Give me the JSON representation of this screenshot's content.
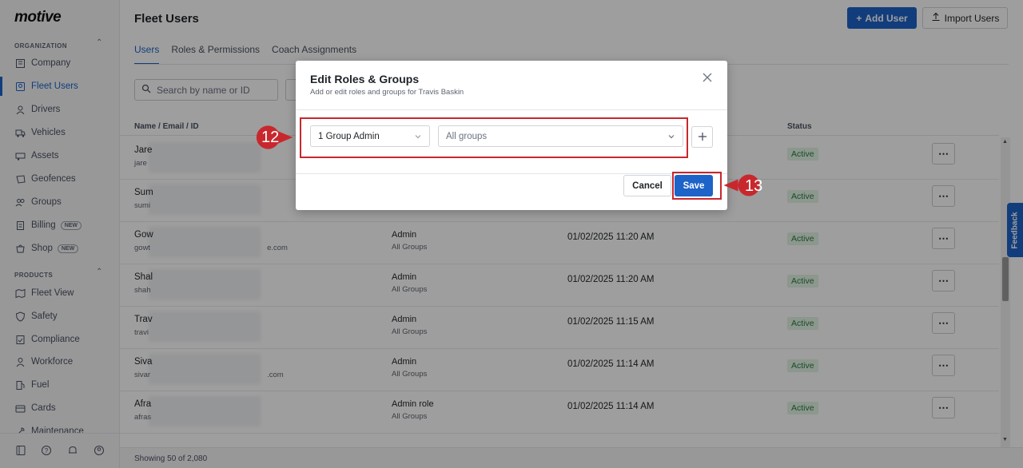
{
  "app": {
    "logo": "motive"
  },
  "sidebar": {
    "organization_label": "ORGANIZATION",
    "products_label": "PRODUCTS",
    "org_items": [
      {
        "label": "Company",
        "icon": "building-icon"
      },
      {
        "label": "Fleet Users",
        "icon": "users-icon",
        "active": true
      },
      {
        "label": "Drivers",
        "icon": "driver-icon"
      },
      {
        "label": "Vehicles",
        "icon": "truck-icon"
      },
      {
        "label": "Assets",
        "icon": "trailer-icon"
      },
      {
        "label": "Geofences",
        "icon": "geofence-icon"
      },
      {
        "label": "Groups",
        "icon": "groups-icon"
      },
      {
        "label": "Billing",
        "icon": "billing-icon",
        "badge": "NEW"
      },
      {
        "label": "Shop",
        "icon": "shop-icon",
        "badge": "NEW"
      }
    ],
    "product_items": [
      {
        "label": "Fleet View",
        "icon": "map-icon"
      },
      {
        "label": "Safety",
        "icon": "shield-icon"
      },
      {
        "label": "Compliance",
        "icon": "compliance-icon"
      },
      {
        "label": "Workforce",
        "icon": "workforce-icon"
      },
      {
        "label": "Fuel",
        "icon": "fuel-icon"
      },
      {
        "label": "Cards",
        "icon": "card-icon"
      },
      {
        "label": "Maintenance",
        "icon": "maintenance-icon"
      }
    ]
  },
  "header": {
    "title": "Fleet Users",
    "add_user": "Add User",
    "import_users": "Import Users"
  },
  "tabs": [
    "Users",
    "Roles & Permissions",
    "Coach Assignments"
  ],
  "search": {
    "placeholder": "Search by name or ID"
  },
  "table": {
    "columns": {
      "name": "Name / Email / ID",
      "status": "Status"
    },
    "rows": [
      {
        "name": "Jare",
        "email": "jare",
        "role": "",
        "group": "",
        "date": "",
        "status": "Active"
      },
      {
        "name": "Sum",
        "email": "sumi",
        "role": "",
        "group": "",
        "date": "",
        "status": "Active"
      },
      {
        "name": "Gow",
        "email": "gowt",
        "email_tail": "e.com",
        "role": "Admin",
        "group": "All Groups",
        "date": "01/02/2025 11:20 AM",
        "status": "Active"
      },
      {
        "name": "Shal",
        "email": "shah",
        "role": "Admin",
        "group": "All Groups",
        "date": "01/02/2025 11:20 AM",
        "status": "Active"
      },
      {
        "name": "Trav",
        "email": "travi",
        "role": "Admin",
        "group": "All Groups",
        "date": "01/02/2025 11:15 AM",
        "status": "Active"
      },
      {
        "name": "Siva",
        "email": "sivar",
        "email_tail": ".com",
        "role": "Admin",
        "group": "All Groups",
        "date": "01/02/2025 11:14 AM",
        "status": "Active"
      },
      {
        "name": "Afra",
        "email": "afras",
        "role": "Admin role",
        "group": "All Groups",
        "date": "01/02/2025 11:14 AM",
        "status": "Active"
      }
    ],
    "more": "⋯"
  },
  "footer": {
    "showing": "Showing 50 of 2,080"
  },
  "feedback": "Feedback",
  "modal": {
    "title": "Edit Roles & Groups",
    "subtitle": "Add or edit roles and groups for Travis Baskin",
    "role_value": "1 Group Admin",
    "group_value": "All groups",
    "cancel": "Cancel",
    "save": "Save"
  },
  "callouts": {
    "step_12": "12",
    "step_13": "13",
    "color": "#c8282d"
  },
  "colors": {
    "primary": "#1d63c8",
    "active_bg": "#e3f4e6",
    "active_text": "#2b7a3f"
  }
}
